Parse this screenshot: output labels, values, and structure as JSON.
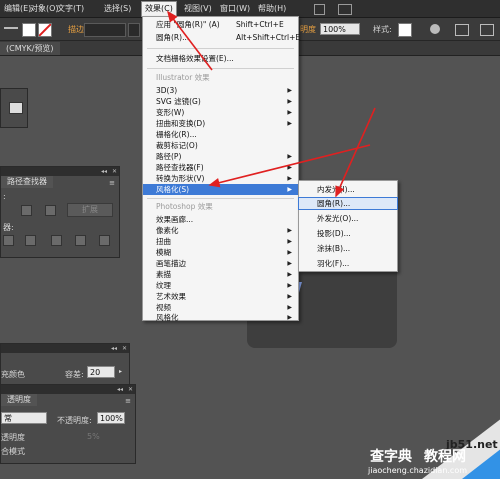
{
  "menubar": {
    "items": [
      "编辑(E)",
      "对象(O)",
      "文字(T)",
      "选择(S)",
      "效果(C)",
      "视图(V)",
      "窗口(W)",
      "帮助(H)"
    ]
  },
  "controlbar": {
    "stroke_label": "描边",
    "opacity_label": "明度",
    "opacity_value": "100%",
    "style_label": "样式:"
  },
  "doc_tab": "(CMYK/预览)",
  "panels": {
    "pathfinder": {
      "title": "路径查找器",
      "shape_mode": ":",
      "pathfinders": "器:",
      "expand_label": "扩展"
    },
    "color": {
      "fill_label": "充颜色",
      "tolerance_label": "容差:",
      "tolerance_value": "20"
    },
    "transparency": {
      "title": "透明度",
      "mode_value": "常",
      "opacity_label": "不透明度:",
      "opacity_value": "100%",
      "row1": "透明度",
      "row1_value": "5%",
      "row2": "合模式"
    }
  },
  "effect_menu": {
    "apply_last": "应用 \"圆角(R)\" (A)",
    "apply_last_shortcut": "Shift+Ctrl+E",
    "last_effect": "圆角(R)...",
    "last_effect_shortcut": "Alt+Shift+Ctrl+E",
    "doc_raster_settings": "文档栅格效果设置(E)...",
    "illustrator_header": "Illustrator 效果",
    "illustrator_items": [
      "3D(3)",
      "SVG 滤镜(G)",
      "变形(W)",
      "扭曲和变换(D)",
      "栅格化(R)...",
      "裁剪标记(O)",
      "路径(P)",
      "路径查找器(F)",
      "转换为形状(V)",
      "风格化(S)"
    ],
    "photoshop_header": "Photoshop 效果",
    "photoshop_items": [
      "效果画廊...",
      "像素化",
      "扭曲",
      "模糊",
      "画笔描边",
      "素描",
      "纹理",
      "艺术效果",
      "视频",
      "风格化"
    ]
  },
  "stylize_submenu": {
    "items": [
      "内发光(I)...",
      "圆角(R)...",
      "外发光(O)...",
      "投影(D)...",
      "涂抹(B)...",
      "羽化(F)..."
    ]
  },
  "watermark": {
    "site": "jb51.net",
    "text1": "查字典",
    "text2": "教程网",
    "url": "jiaocheng.chazidian.com"
  },
  "colors": {
    "highlight": "#3d7ad6",
    "arrow": "#e02020"
  }
}
